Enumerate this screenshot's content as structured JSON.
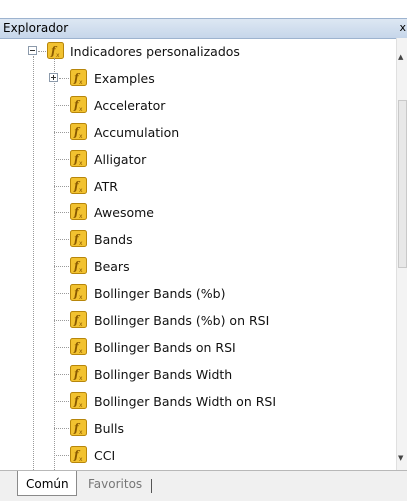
{
  "panel": {
    "title": "Explorador",
    "close_label": "x"
  },
  "tree": {
    "root": {
      "label": "Indicadores personalizados",
      "icon": "fx-indicator-icon"
    },
    "children": [
      {
        "label": "Examples",
        "expandable": true
      },
      {
        "label": "Accelerator"
      },
      {
        "label": "Accumulation"
      },
      {
        "label": "Alligator"
      },
      {
        "label": "ATR"
      },
      {
        "label": "Awesome"
      },
      {
        "label": "Bands"
      },
      {
        "label": "Bears"
      },
      {
        "label": "Bollinger Bands (%b)"
      },
      {
        "label": "Bollinger Bands (%b) on RSI"
      },
      {
        "label": "Bollinger Bands on RSI"
      },
      {
        "label": "Bollinger Bands Width"
      },
      {
        "label": "Bollinger Bands Width on RSI"
      },
      {
        "label": "Bulls"
      },
      {
        "label": "CCI"
      }
    ]
  },
  "scrollbar": {
    "up_icon": "scroll-up-arrow-icon",
    "down_icon": "scroll-down-arrow-icon",
    "grip": "≡"
  },
  "tabs": {
    "active": "Común",
    "inactive": "Favoritos"
  },
  "colors": {
    "title_bg": "#c6d6ea",
    "icon_fill": "#f2c230",
    "icon_border": "#b7860b"
  }
}
